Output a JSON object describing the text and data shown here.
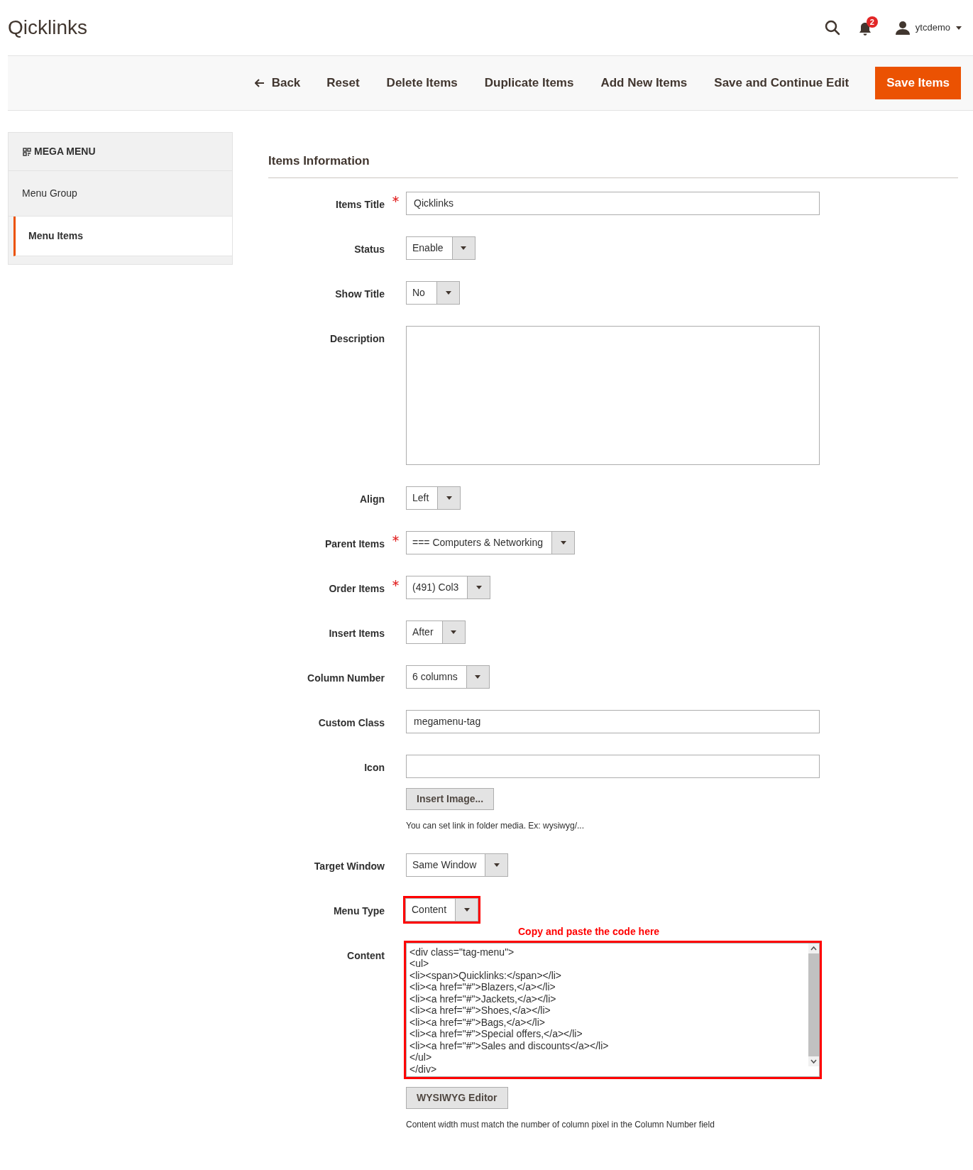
{
  "page_title": "Qicklinks",
  "header": {
    "notification_count": "2",
    "user": "ytcdemo"
  },
  "toolbar": [
    {
      "label": "Back",
      "kind": "back"
    },
    {
      "label": "Reset",
      "kind": "link"
    },
    {
      "label": "Delete Items",
      "kind": "link"
    },
    {
      "label": "Duplicate Items",
      "kind": "link"
    },
    {
      "label": "Add New Items",
      "kind": "link"
    },
    {
      "label": "Save and Continue Edit",
      "kind": "link"
    },
    {
      "label": "Save Items",
      "kind": "primary"
    }
  ],
  "sidebar": {
    "title": "MEGA MENU",
    "items": [
      {
        "label": "Menu Group",
        "selected": false
      },
      {
        "label": "Menu Items",
        "selected": true
      }
    ]
  },
  "section_title": "Items Information",
  "fields": [
    {
      "label": "Items Title",
      "kind": "text",
      "required": true,
      "value": "Qicklinks",
      "highlighted": false
    },
    {
      "label": "Status",
      "kind": "select",
      "required": false,
      "value": "Enable",
      "highlighted": false
    },
    {
      "label": "Show Title",
      "kind": "select",
      "required": false,
      "value": "No",
      "highlighted": false
    },
    {
      "label": "Description",
      "kind": "textarea",
      "required": false,
      "highlighted": false
    },
    {
      "label": "Align",
      "kind": "select",
      "required": false,
      "value": "Left",
      "highlighted": false
    },
    {
      "label": "Parent Items",
      "kind": "select",
      "required": true,
      "value": "=== Computers & Networking",
      "highlighted": false
    },
    {
      "label": "Order Items",
      "kind": "select",
      "required": true,
      "value": "(491) Col3",
      "highlighted": false
    },
    {
      "label": "Insert Items",
      "kind": "select",
      "required": false,
      "value": "After",
      "highlighted": false
    },
    {
      "label": "Column Number",
      "kind": "select",
      "required": false,
      "value": "6 columns",
      "highlighted": false
    },
    {
      "label": "Custom Class",
      "kind": "text",
      "required": false,
      "value": "megamenu-tag",
      "highlighted": false
    },
    {
      "label": "Icon",
      "kind": "text",
      "required": false,
      "highlighted": false,
      "button": "Insert Image...",
      "note": "You can set link in folder media. Ex: wysiwyg/..."
    },
    {
      "label": "Target Window",
      "kind": "select",
      "required": false,
      "value": "Same Window",
      "highlighted": false
    },
    {
      "label": "Menu Type",
      "kind": "select",
      "required": false,
      "value": "Content",
      "highlighted": true,
      "annotation": "Copy and paste the code here"
    },
    {
      "label": "Content",
      "kind": "code",
      "required": false,
      "highlighted": true,
      "value": "<div class=\"tag-menu\">\n<ul>\n<li><span>Quicklinks:</span></li>\n<li><a href=\"#\">Blazers,</a></li>\n<li><a href=\"#\">Jackets,</a></li>\n<li><a href=\"#\">Shoes,</a></li>\n<li><a href=\"#\">Bags,</a></li>\n<li><a href=\"#\">Special offers,</a></li>\n<li><a href=\"#\">Sales and discounts</a></li>\n</ul>\n</div>",
      "button": "WYSIWYG Editor",
      "note": "Content width must match the number of column pixel in the Column Number field"
    }
  ]
}
